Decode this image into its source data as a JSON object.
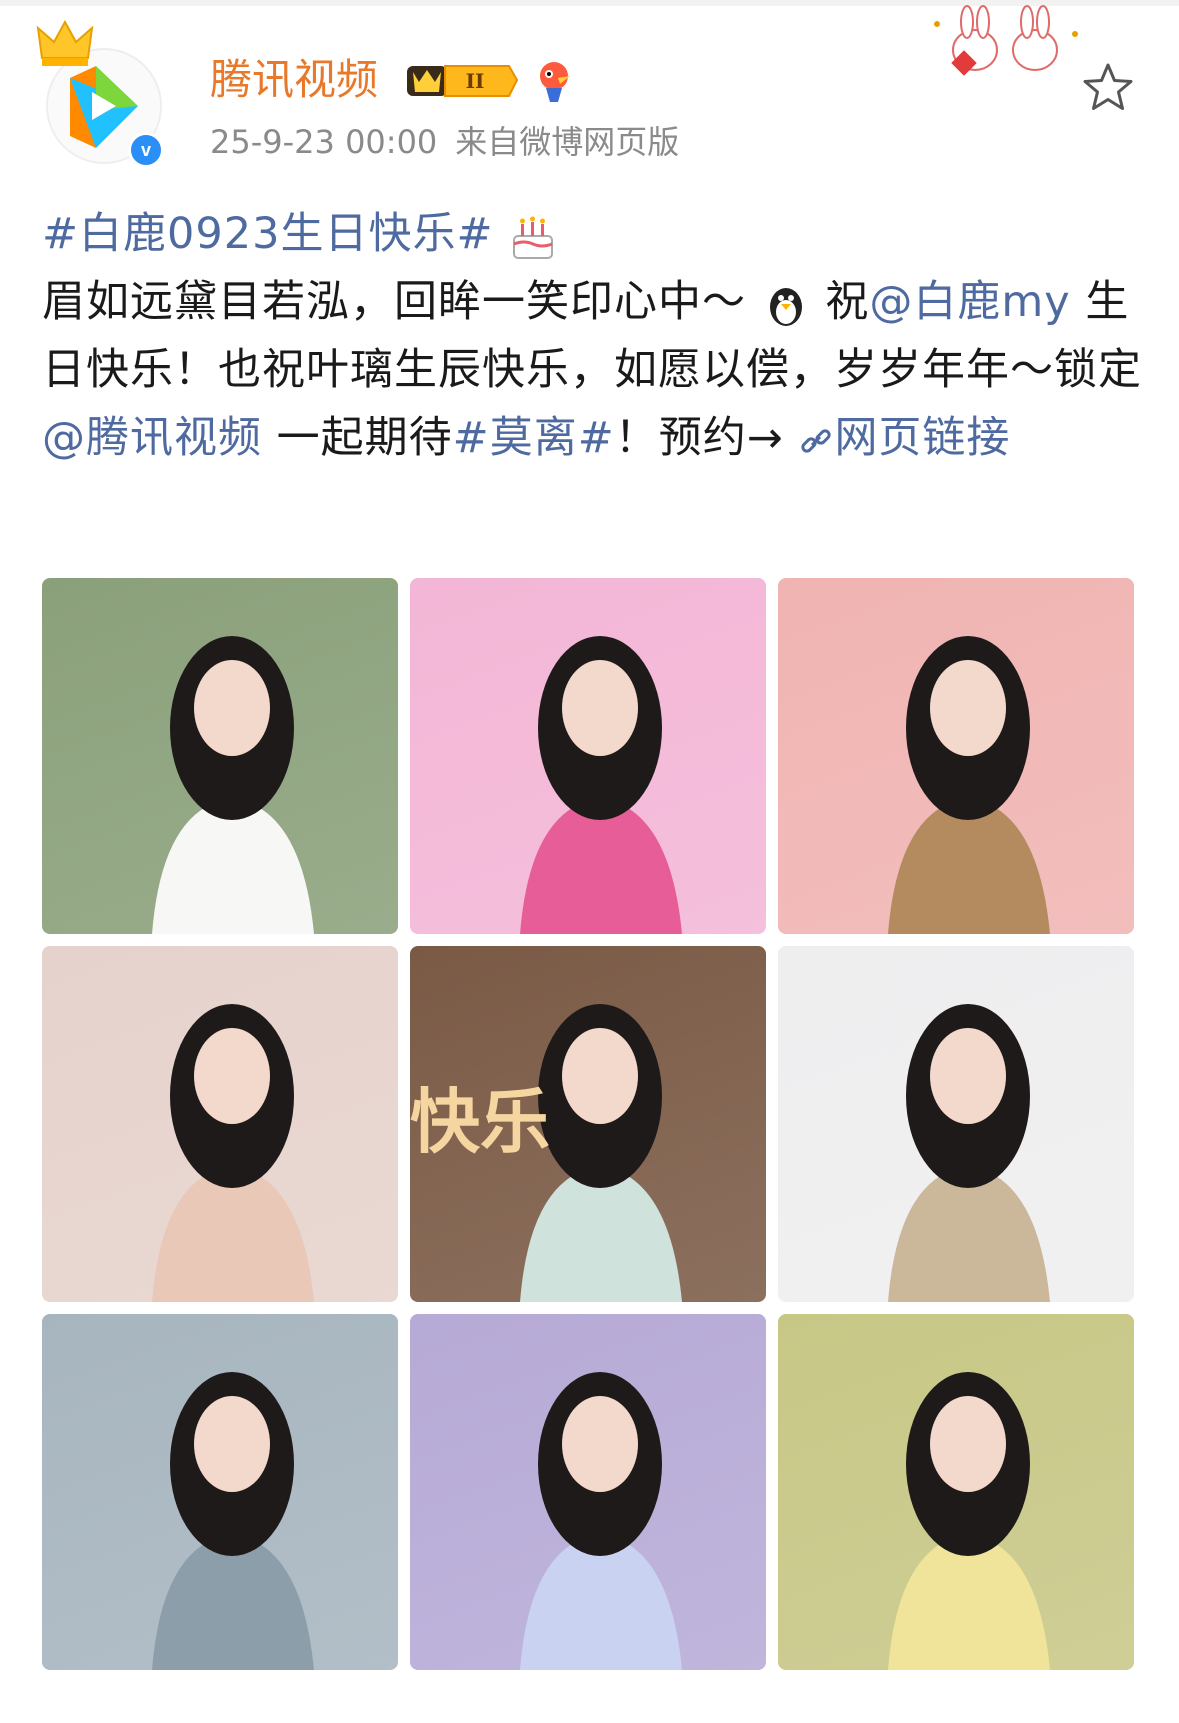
{
  "user": {
    "name": "腾讯视频",
    "vip_level": "II",
    "verified_mark": "v",
    "timestamp": "25-9-23 00:00",
    "source": "来自微博网页版"
  },
  "post": {
    "hashtag_open": "#白鹿0923生日快乐#",
    "line1_text": "眉如远黛目若泓，回眸一笑印心中～",
    "wish_prefix": "祝",
    "mention1": "@白鹿my",
    "line2_text": " 生日快乐！也祝叶璃生辰快乐，如愿以偿，岁岁年年～锁定",
    "mention2": "@腾讯视频",
    "line3_text": " 一起期待",
    "hashtag_show": "#莫离#",
    "line4_text": "！预约→",
    "weblink": "网页链接"
  },
  "photos": [
    {
      "name": "photo-1",
      "bg": "#8aa07a",
      "accent": "#f7f7f5"
    },
    {
      "name": "photo-2",
      "bg": "#f3b6d6",
      "accent": "#e75d97"
    },
    {
      "name": "photo-3",
      "bg": "#f0b4b2",
      "accent": "#b38b5f"
    },
    {
      "name": "photo-4",
      "bg": "#e6d2cc",
      "accent": "#e9c8b7"
    },
    {
      "name": "photo-5",
      "bg": "#7a5a45",
      "accent": "#cfe3dc",
      "overlay_text": "快乐"
    },
    {
      "name": "photo-6",
      "bg": "#eeeeef",
      "accent": "#cbb89b"
    },
    {
      "name": "photo-7",
      "bg": "#a7b5bf",
      "accent": "#8d9eab"
    },
    {
      "name": "photo-8",
      "bg": "#b6aad6",
      "accent": "#c9d2f0"
    },
    {
      "name": "photo-9",
      "bg": "#c7c786",
      "accent": "#f0e49a"
    }
  ],
  "icons": {
    "crown": "crown-icon",
    "verified": "verified-badge-icon",
    "star": "star-icon",
    "cake": "birthday-cake-icon",
    "penguin": "penguin-icon",
    "link": "link-icon"
  },
  "colors": {
    "username": "#e8792b",
    "link": "#4e6aa0",
    "meta": "#8a8a8a",
    "verified": "#2a8ff7"
  }
}
